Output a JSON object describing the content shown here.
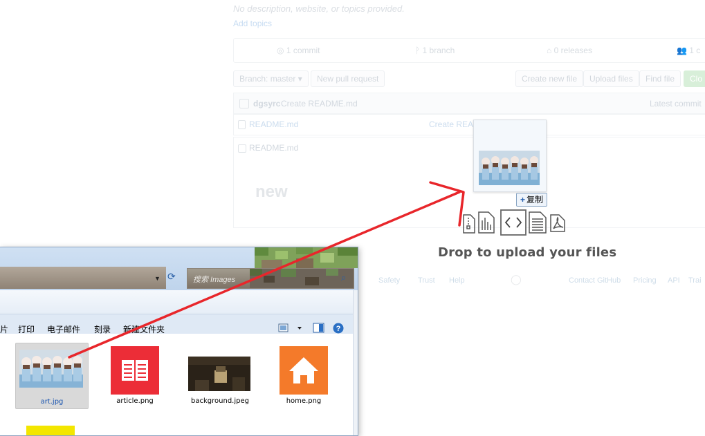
{
  "github": {
    "description": "No description, website, or topics provided.",
    "add_topics": "Add topics",
    "stats": {
      "commits": "1 commit",
      "branches": "1 branch",
      "releases": "0 releases",
      "contributors": "1 c"
    },
    "branch_button": "Branch: master ▾",
    "new_pull_request": "New pull request",
    "create_new_file": "Create new file",
    "upload_files": "Upload files",
    "find_file": "Find file",
    "clone_button": "Clo",
    "commit_author": "dgsyrc",
    "commit_message": "Create README.md",
    "latest_commit": "Latest commit",
    "file_row": {
      "name": "README.md",
      "message": "Create README.md"
    },
    "readme_header": "README.md",
    "readme_heading": "new",
    "footer_links": [
      "Safety",
      "Trust",
      "Help"
    ],
    "footer_right": [
      "Contact GitHub",
      "Pricing",
      "API",
      "Trai"
    ]
  },
  "drop_overlay": {
    "copy_badge": "复制",
    "copy_plus": "+",
    "drop_text": "Drop to upload your files"
  },
  "explorer": {
    "search_placeholder": "搜索 Images",
    "toolbar_items": [
      "片",
      "打印",
      "电子邮件",
      "刻录",
      "新建文件夹"
    ],
    "files": [
      {
        "name": "art.jpg",
        "selected": true
      },
      {
        "name": "article.png",
        "selected": false
      },
      {
        "name": "background.jpeg",
        "selected": false
      },
      {
        "name": "home.png",
        "selected": false
      }
    ]
  },
  "colors": {
    "arrow": "#e8262b",
    "article_icon_bg": "#ec2d37",
    "home_icon_bg": "#f47a2a",
    "selection_text": "#1a55b0"
  }
}
